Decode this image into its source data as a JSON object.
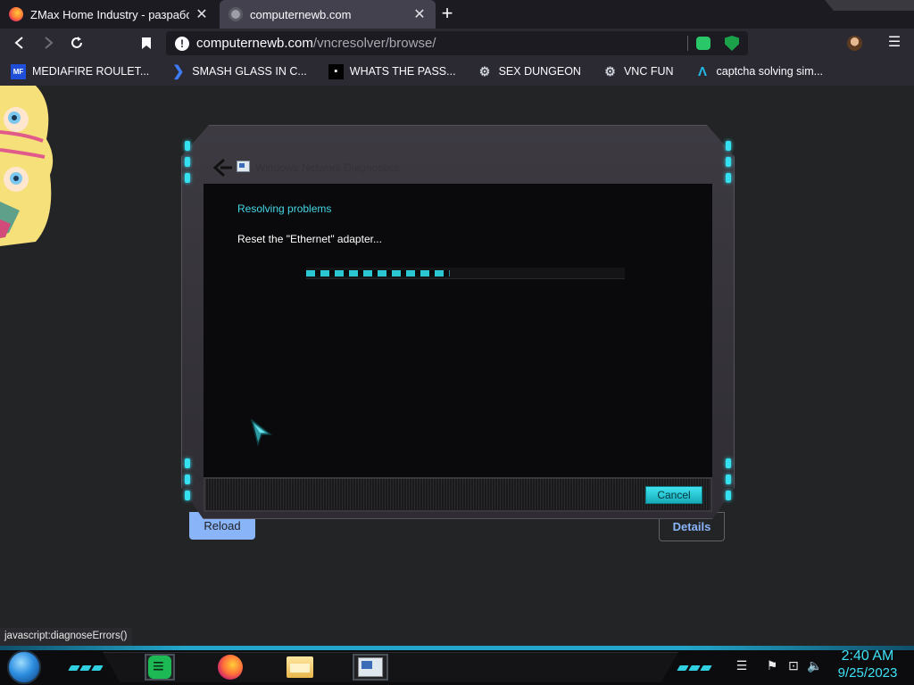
{
  "browser": {
    "tabs": [
      {
        "title": "ZMax Home Industry - разработк",
        "active": false,
        "favicon": "firefox-icon",
        "favicon_color": "#ff7139"
      },
      {
        "title": "computernewb.com",
        "active": true,
        "favicon": "globe-icon",
        "favicon_color": "#9e9ea6"
      }
    ],
    "tab_close_glyph": "✕",
    "new_tab_glyph": "+",
    "url_host": "computernewb.com",
    "url_path": "/vncresolver/browse/",
    "bookmarks": [
      {
        "label": "MEDIAFIRE ROULET...",
        "icon": "mediafire-icon",
        "icon_text": "MF",
        "color": "#1f4fd8"
      },
      {
        "label": "SMASH GLASS IN C...",
        "icon": "vscode-icon",
        "icon_text": "❯",
        "color": "#3d7bf5"
      },
      {
        "label": "WHATS THE PASS...",
        "icon": "lock-icon",
        "icon_text": "▪",
        "color": "#000000"
      },
      {
        "label": "SEX DUNGEON",
        "icon": "vnc-icon",
        "icon_text": "⚙",
        "color": "#cfd3dc"
      },
      {
        "label": "VNC FUN",
        "icon": "vnc-icon",
        "icon_text": "⚙",
        "color": "#cfd3dc"
      },
      {
        "label": "captcha solving sim...",
        "icon": "arch-icon",
        "icon_text": "Λ",
        "color": "#23b9e6"
      }
    ]
  },
  "page": {
    "reload_label": "Reload",
    "details_label": "Details"
  },
  "dialog": {
    "title": "Windows Network Diagnostics",
    "heading": "Resolving problems",
    "message": "Reset the \"Ethernet\" adapter...",
    "progress_fraction": 0.45,
    "cancel_label": "Cancel"
  },
  "status_text": "javascript:diagnoseErrors()",
  "taskbar": {
    "apps": [
      {
        "name": "spotify-icon",
        "active": true
      },
      {
        "name": "firefox-icon",
        "active": false
      },
      {
        "name": "file-explorer-icon",
        "active": false
      },
      {
        "name": "network-diagnostics-icon",
        "active": true
      }
    ],
    "time": "2:40 AM",
    "date": "9/25/2023"
  }
}
